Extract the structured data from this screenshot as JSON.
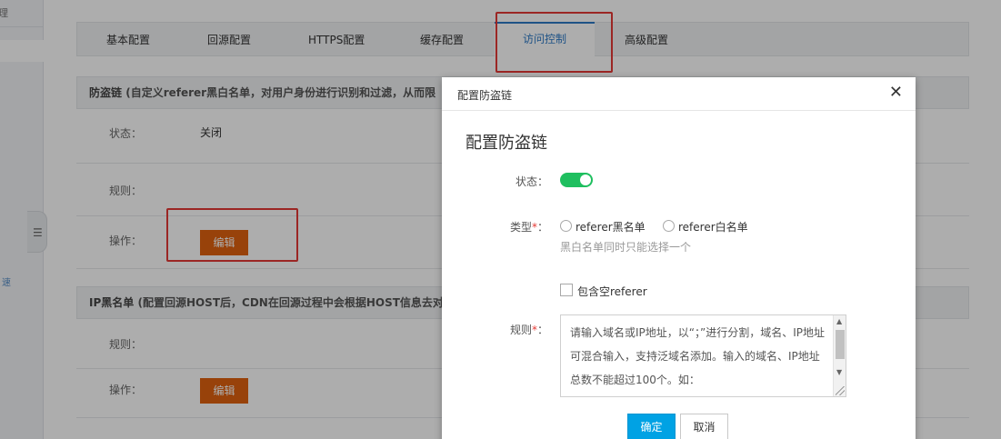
{
  "sidebar": {
    "top_label": "理",
    "side_char": "速",
    "toggle_icon": "list-icon"
  },
  "tabs": [
    {
      "label": "基本配置",
      "active": false
    },
    {
      "label": "回源配置",
      "active": false
    },
    {
      "label": "HTTPS配置",
      "active": false
    },
    {
      "label": "缓存配置",
      "active": false
    },
    {
      "label": "访问控制",
      "active": true
    },
    {
      "label": "高级配置",
      "active": false
    }
  ],
  "referer_section": {
    "title": "防盗链",
    "description": "(自定义referer黑白名单，对用户身份进行识别和过滤，从而限",
    "status_label": "状态：",
    "status_value": "关闭",
    "rules_label": "规则：",
    "action_label": "操作：",
    "edit_label": "编辑"
  },
  "ip_section": {
    "title": "IP黑名单",
    "description": "(配置回源HOST后，CDN在回源过程中会根据HOST信息去对",
    "rules_label": "规则：",
    "action_label": "操作：",
    "edit_label": "编辑"
  },
  "dialog": {
    "title": "配置防盗链",
    "close_icon": "close-icon",
    "heading": "配置防盗链",
    "status_label": "状态：",
    "status_on": true,
    "type_label": "类型",
    "type_suffix": "：",
    "required_mark": "*",
    "type_options": [
      "referer黑名单",
      "referer白名单"
    ],
    "type_hint": "黑白名单同时只能选择一个",
    "include_empty_label": "包含空referer",
    "include_empty_checked": false,
    "rules_label": "规则",
    "rules_placeholder": "请输入域名或IP地址，以“；”进行分割，域名、IP地址可混合输入，支持泛域名添加。输入的域名、IP地址总数不能超过100个。如：",
    "ok_label": "确定",
    "cancel_label": "取消"
  },
  "colors": {
    "accent_blue": "#00a2e4",
    "edit_orange": "#e0620f",
    "toggle_green": "#1fbf5f",
    "highlight_red": "#e53935"
  }
}
